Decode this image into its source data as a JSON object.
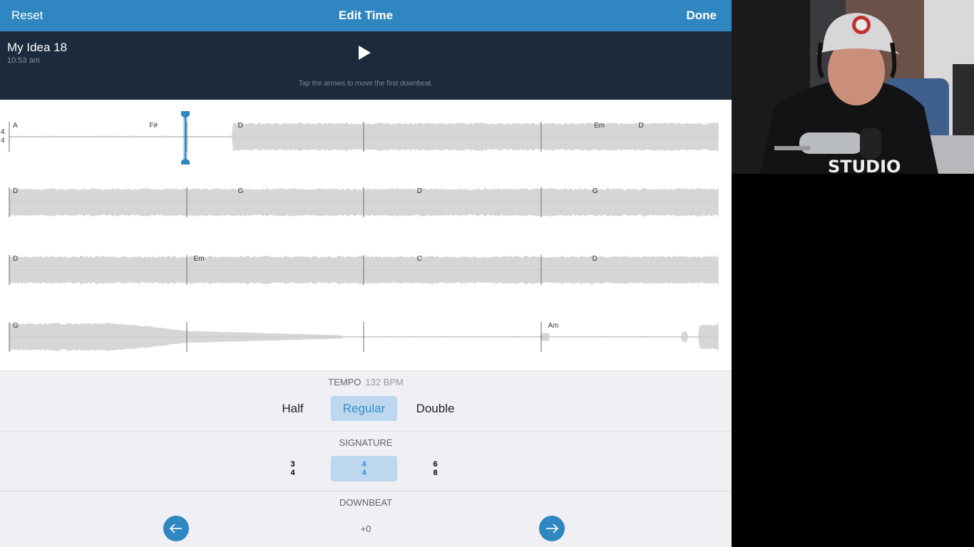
{
  "header": {
    "reset": "Reset",
    "title": "Edit Time",
    "done": "Done"
  },
  "song": {
    "name": "My Idea 18",
    "time": "10:53 am",
    "hint": "Tap the arrows to move the first downbeat."
  },
  "time_signature_marker": {
    "top": "4",
    "bottom": "4"
  },
  "rows": [
    {
      "chords": [
        {
          "label": "A",
          "bar": 0.0
        },
        {
          "label": "F#",
          "bar": 0.77
        },
        {
          "label": "D",
          "bar": 1.27
        },
        {
          "label": "Em",
          "bar": 3.28
        },
        {
          "label": "D",
          "bar": 3.53
        }
      ]
    },
    {
      "chords": [
        {
          "label": "D",
          "bar": 0.0
        },
        {
          "label": "G",
          "bar": 1.27
        },
        {
          "label": "D",
          "bar": 2.28
        },
        {
          "label": "G",
          "bar": 3.27
        }
      ]
    },
    {
      "chords": [
        {
          "label": "D",
          "bar": 0.0
        },
        {
          "label": "Em",
          "bar": 1.02
        },
        {
          "label": "C",
          "bar": 2.28
        },
        {
          "label": "D",
          "bar": 3.27
        }
      ]
    },
    {
      "chords": [
        {
          "label": "G",
          "bar": 0.0
        },
        {
          "label": "Am",
          "bar": 3.02
        }
      ]
    }
  ],
  "tempo": {
    "label": "TEMPO",
    "bpm": "132 BPM",
    "options": [
      "Half",
      "Regular",
      "Double"
    ],
    "selected": "Regular"
  },
  "signature": {
    "label": "SIGNATURE",
    "options": [
      {
        "top": "3",
        "bottom": "4"
      },
      {
        "top": "4",
        "bottom": "4"
      },
      {
        "top": "6",
        "bottom": "8"
      }
    ],
    "selected_index": 1
  },
  "downbeat": {
    "label": "DOWNBEAT",
    "offset": "+0"
  },
  "colors": {
    "accent": "#2f86c0",
    "header_dark": "#1d2a3c",
    "waveform": "#d6d6d6",
    "selected_bg": "#bcd7ee"
  }
}
